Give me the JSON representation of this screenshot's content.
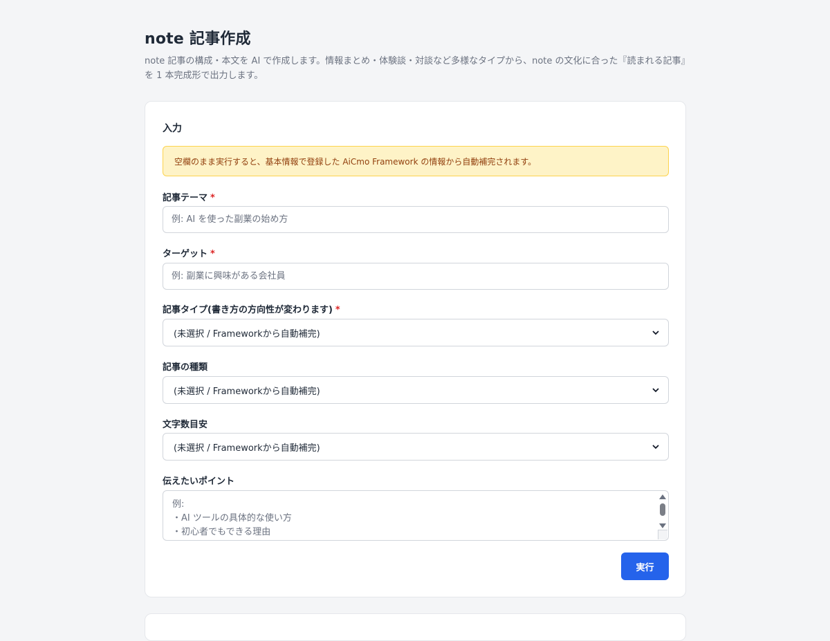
{
  "header": {
    "title": "note 記事作成",
    "description": "note 記事の構成・本文を AI で作成します。情報まとめ・体験談・対談など多様なタイプから、note の文化に合った『読まれる記事』を 1 本完成形で出力します。"
  },
  "form": {
    "section_title": "入力",
    "notice": "空欄のまま実行すると、基本情報で登録した AiCmo Framework の情報から自動補完されます。",
    "required_mark": "*",
    "theme": {
      "label": "記事テーマ",
      "placeholder": "例: AI を使った副業の始め方"
    },
    "target": {
      "label": "ターゲット",
      "placeholder": "例: 副業に興味がある会社員"
    },
    "article_type": {
      "label": "記事タイプ(書き方の方向性が変わります)",
      "selected": "(未選択 / Frameworkから自動補完)"
    },
    "genre": {
      "label": "記事の種類",
      "selected": "(未選択 / Frameworkから自動補完)"
    },
    "length": {
      "label": "文字数目安",
      "selected": "(未選択 / Frameworkから自動補完)"
    },
    "points": {
      "label": "伝えたいポイント",
      "placeholder": "例:\n・AI ツールの具体的な使い方\n・初心者でもできる理由\n・実際の収益例"
    },
    "submit_label": "実行"
  }
}
